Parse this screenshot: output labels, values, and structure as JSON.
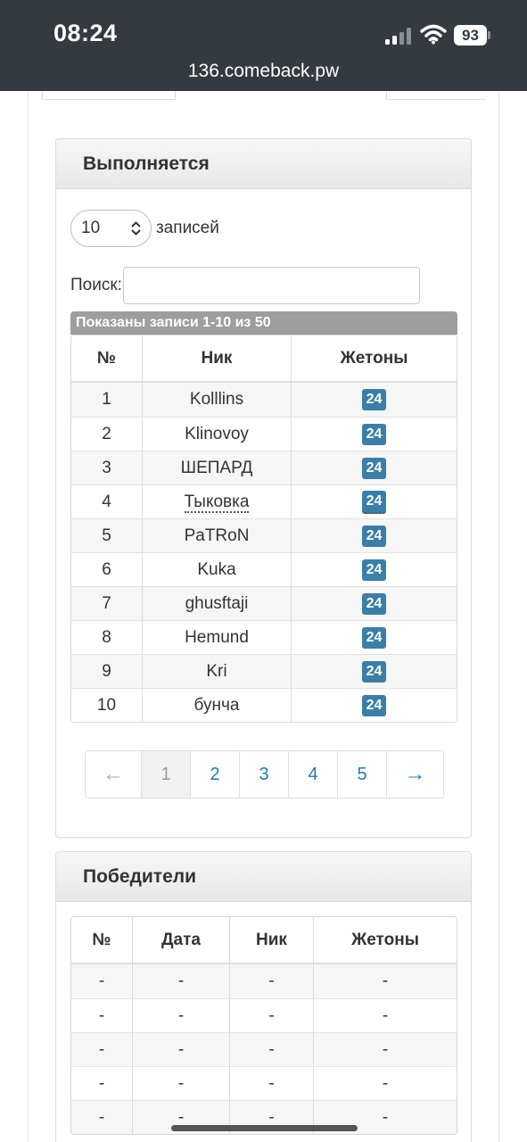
{
  "status_bar": {
    "time": "08:24",
    "battery": "93"
  },
  "url_bar": {
    "url": "136.comeback.pw"
  },
  "running": {
    "title": "Выполняется",
    "page_length": "10",
    "page_length_label": "записей",
    "search_label": "Поиск:",
    "search_value": "",
    "info": "Показаны записи 1-10 из 50",
    "columns": [
      "№",
      "Ник",
      "Жетоны"
    ],
    "rows": [
      {
        "n": "1",
        "nick": "Kolllins",
        "tokens": "24"
      },
      {
        "n": "2",
        "nick": "Klinovoy",
        "tokens": "24"
      },
      {
        "n": "3",
        "nick": "ШЕПАРД",
        "tokens": "24"
      },
      {
        "n": "4",
        "nick": "Тыковка",
        "tokens": "24"
      },
      {
        "n": "5",
        "nick": "PaTRoN",
        "tokens": "24"
      },
      {
        "n": "6",
        "nick": "Kuka",
        "tokens": "24"
      },
      {
        "n": "7",
        "nick": "ghusftaji",
        "tokens": "24"
      },
      {
        "n": "8",
        "nick": "Hemund",
        "tokens": "24"
      },
      {
        "n": "9",
        "nick": "Kri",
        "tokens": "24"
      },
      {
        "n": "10",
        "nick": "бунча",
        "tokens": "24"
      }
    ],
    "pagination": {
      "prev": "←",
      "pages": [
        "1",
        "2",
        "3",
        "4",
        "5"
      ],
      "active": "1",
      "next": "→"
    }
  },
  "winners": {
    "title": "Победители",
    "columns": [
      "№",
      "Дата",
      "Ник",
      "Жетоны"
    ],
    "rows": [
      [
        "-",
        "-",
        "-",
        "-"
      ],
      [
        "-",
        "-",
        "-",
        "-"
      ],
      [
        "-",
        "-",
        "-",
        "-"
      ],
      [
        "-",
        "-",
        "-",
        "-"
      ],
      [
        "-",
        "-",
        "-",
        "-"
      ]
    ]
  },
  "colors": {
    "token_badge": "#3a7fa8",
    "link": "#1a7bb9",
    "topbar": "#343a40",
    "info_bar": "#9e9e9e"
  }
}
